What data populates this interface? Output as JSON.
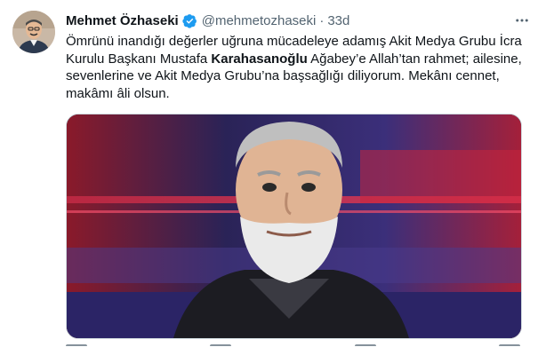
{
  "tweet": {
    "author_name": "Mehmet Özhaseki",
    "handle": "@mehmetozhaseki",
    "separator": "·",
    "time": "33d",
    "text_part1": "Ömrünü inandığı değerler uğruna mücadeleye adamış Akit Medya Grubu İcra Kurulu Başkanı Mustafa ",
    "text_bold": "Karahasanoğlu",
    "text_part2": " Ağabey’e Allah’tan rahmet; ailesine, sevenlerine ve Akit Medya Grubu’na başsağlığı diliyorum. Mekânı cennet, makâmı âli olsun.",
    "icons": {
      "verified": "verified-badge-icon",
      "more": "more-options-icon"
    },
    "colors": {
      "verified": "#1d9bf0",
      "secondary_text": "#536471",
      "primary_text": "#0f1419"
    }
  }
}
